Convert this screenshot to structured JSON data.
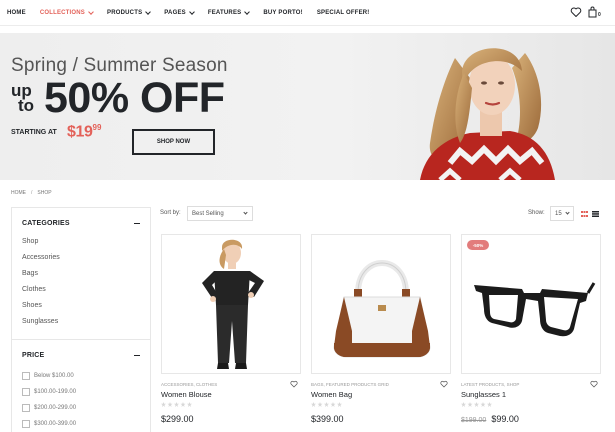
{
  "nav": {
    "items": [
      {
        "label": "HOME",
        "dropdown": false,
        "active": false
      },
      {
        "label": "COLLECTIONS",
        "dropdown": true,
        "active": true
      },
      {
        "label": "PRODUCTS",
        "dropdown": true,
        "active": false
      },
      {
        "label": "PAGES",
        "dropdown": true,
        "active": false
      },
      {
        "label": "FEATURES",
        "dropdown": true,
        "active": false
      },
      {
        "label": "BUY PORTO!",
        "dropdown": false,
        "active": false
      },
      {
        "label": "SPECIAL OFFER!",
        "dropdown": false,
        "active": false
      }
    ],
    "wishlist_icon": "heart-icon",
    "cart_icon": "shopping-bag-icon",
    "cart_count": "0"
  },
  "banner": {
    "season": "Spring / Summer Season",
    "up": "up",
    "to": "to",
    "discount": "50% OFF",
    "starting_at": "STARTING AT",
    "price_main": "$19",
    "price_cents": "99",
    "shop_button": "SHOP NOW"
  },
  "breadcrumb": {
    "home": "HOME",
    "separator": "/",
    "current": "SHOP"
  },
  "sidebar": {
    "categories_title": "CATEGORIES",
    "categories": [
      "Shop",
      "Accessories",
      "Bags",
      "Clothes",
      "Shoes",
      "Sunglasses"
    ],
    "price_title": "PRICE",
    "price_ranges": [
      "Below $100.00",
      "$100.00-199.00",
      "$200.00-299.00",
      "$300.00-399.00"
    ]
  },
  "toolbar": {
    "sort_label": "Sort by:",
    "sort_value": "Best Selling",
    "show_label": "Show:",
    "show_value": "15",
    "view_icons": [
      "grid-icon",
      "list-icon"
    ]
  },
  "products": [
    {
      "categories": "ACCESSORIES, CLOTHES",
      "name": "Women Blouse",
      "old_price": "",
      "price": "$299.00",
      "badge": "",
      "rating": 0
    },
    {
      "categories": "BAGS, FEATURED PRODUCTS GRID",
      "name": "Women Bag",
      "old_price": "",
      "price": "$399.00",
      "badge": "",
      "rating": 0
    },
    {
      "categories": "LATEST PRODUCTS, SHOP",
      "name": "Sunglasses 1",
      "old_price": "$199.00",
      "price": "$99.00",
      "badge": "-50%",
      "rating": 0
    }
  ],
  "colors": {
    "accent": "#e36159",
    "text_dark": "#222529",
    "sale_badge": "#e27c7c",
    "border": "#e7e7e7"
  }
}
